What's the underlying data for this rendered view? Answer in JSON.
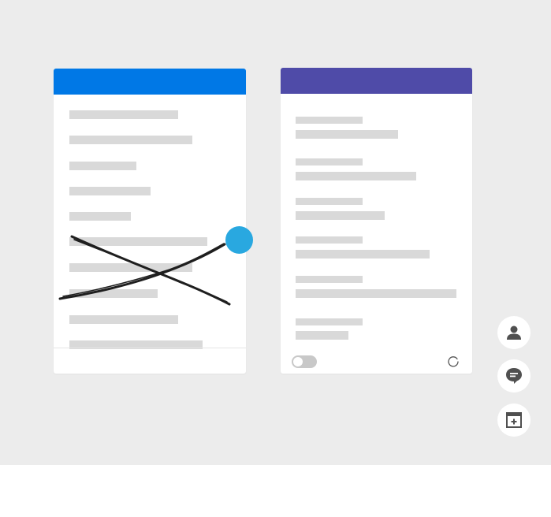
{
  "left_panel": {
    "header_color": "#0078e6",
    "rows": [
      {
        "id": "row-1"
      },
      {
        "id": "row-2"
      },
      {
        "id": "row-3"
      },
      {
        "id": "row-4"
      },
      {
        "id": "row-5"
      },
      {
        "id": "row-6"
      },
      {
        "id": "row-7"
      },
      {
        "id": "row-8"
      },
      {
        "id": "row-9"
      },
      {
        "id": "row-10"
      }
    ],
    "crossed_out": true
  },
  "right_panel": {
    "header_color": "#4f4ba8",
    "fields": [
      {
        "id": "field-1"
      },
      {
        "id": "field-2"
      },
      {
        "id": "field-3"
      },
      {
        "id": "field-4"
      },
      {
        "id": "field-5"
      },
      {
        "id": "field-6"
      }
    ],
    "toggle": {
      "state": "off"
    },
    "spinner_icon": "refresh-icon"
  },
  "drag_handle": {
    "color": "#29a8e0"
  },
  "side_actions": [
    {
      "icon": "person-icon"
    },
    {
      "icon": "chat-icon"
    },
    {
      "icon": "calendar-add-icon"
    }
  ]
}
